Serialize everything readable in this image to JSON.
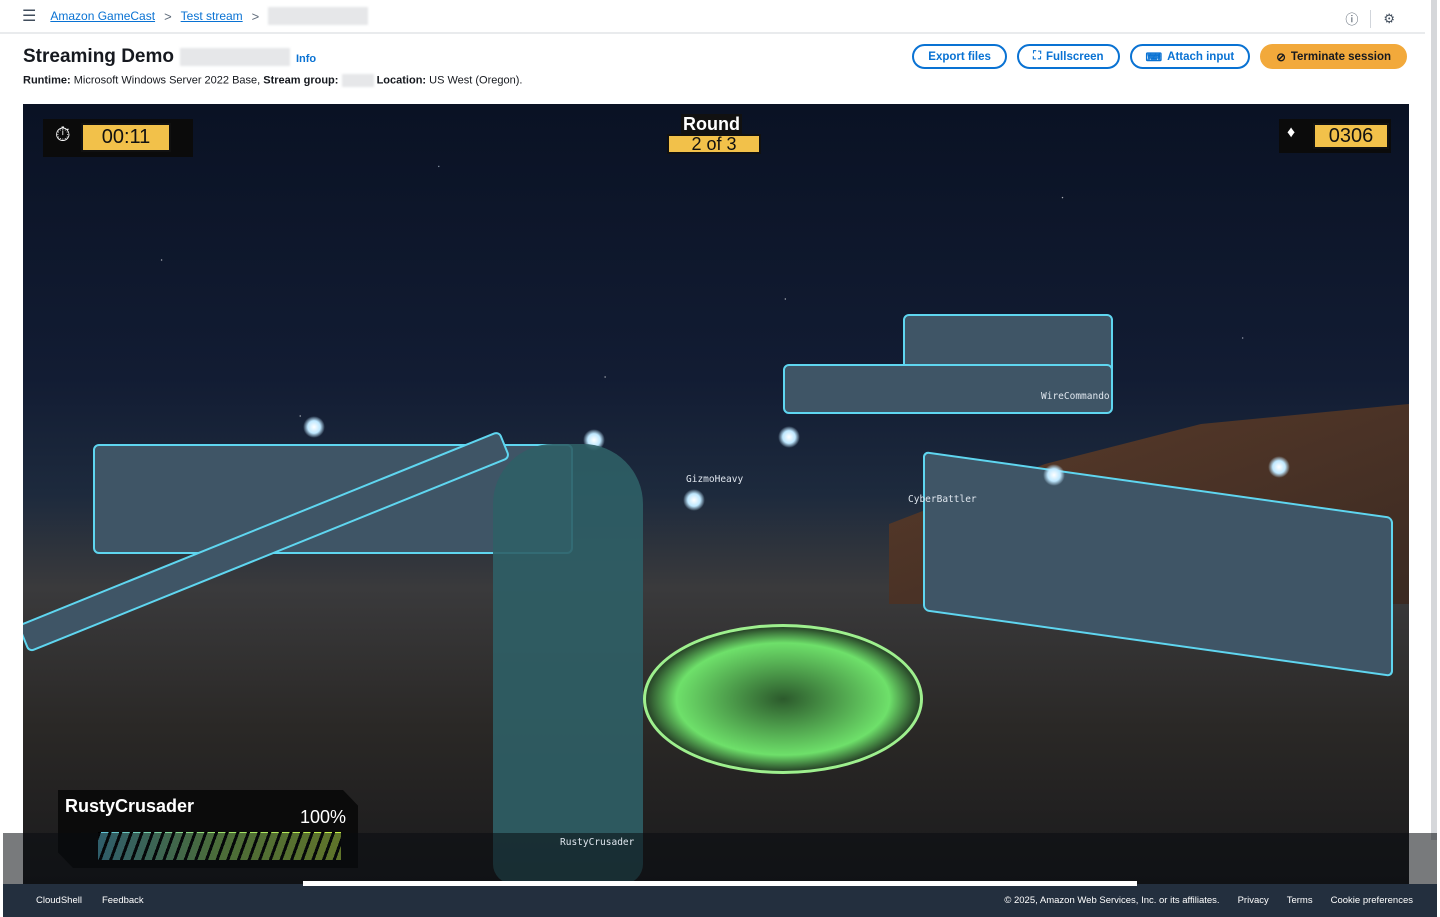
{
  "breadcrumb": {
    "items": [
      "Amazon GameCast",
      "Test stream"
    ]
  },
  "header": {
    "title": "Streaming Demo",
    "info": "Info",
    "runtime_label": "Runtime:",
    "runtime": "Microsoft Windows Server 2022 Base,",
    "stream_group_label": "Stream group:",
    "location_label": "Location:",
    "location": "US West (Oregon)."
  },
  "actions": {
    "export": "Export files",
    "fullscreen": "Fullscreen",
    "attach": "Attach input",
    "terminate": "Terminate session"
  },
  "game": {
    "timer": "00:11",
    "round_label": "Round",
    "round": "2 of 3",
    "score": "0306",
    "player": "RustyCrusader",
    "health": "100%",
    "health_value": 100,
    "tags": [
      "GizmoHeavy",
      "CyberBattler",
      "WireCommando",
      "RustyCrusader"
    ]
  },
  "footer": {
    "cloudshell": "CloudShell",
    "feedback": "Feedback",
    "copyright": "© 2025, Amazon Web Services, Inc. or its affiliates.",
    "privacy": "Privacy",
    "terms": "Terms",
    "cookies": "Cookie preferences"
  }
}
